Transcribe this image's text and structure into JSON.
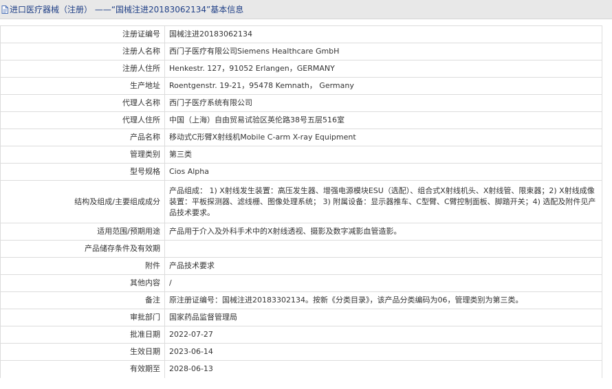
{
  "header": {
    "icon": "document-icon",
    "title": "进口医疗器械（注册） ——“国械注进20183062134”基本信息"
  },
  "rows": [
    {
      "label": "注册证编号",
      "value": "国械注进20183062134"
    },
    {
      "label": "注册人名称",
      "value": "西门子医疗有限公司Siemens Healthcare GmbH"
    },
    {
      "label": "注册人住所",
      "value": "Henkestr. 127，91052 Erlangen，GERMANY"
    },
    {
      "label": "生产地址",
      "value": "Roentgenstr. 19-21，95478 Kemnath， Germany"
    },
    {
      "label": "代理人名称",
      "value": "西门子医疗系统有限公司"
    },
    {
      "label": "代理人住所",
      "value": "中国（上海）自由贸易试验区英伦路38号五层516室"
    },
    {
      "label": "产品名称",
      "value": "移动式C形臂X射线机Mobile C-arm X-ray Equipment"
    },
    {
      "label": "管理类别",
      "value": "第三类"
    },
    {
      "label": "型号规格",
      "value": "Cios Alpha"
    },
    {
      "label": "结构及组成/主要组成成分",
      "value": "产品组成： 1) X射线发生装置：高压发生器、增强电源模块ESU（选配）、组合式X射线机头、X射线管、限束器；2) X射线成像装置：平板探测器、滤线栅、图像处理系统； 3) 附属设备：显示器推车、C型臂、C臂控制面板、脚踏开关；4) 选配及附件见产品技术要求。"
    },
    {
      "label": "适用范围/预期用途",
      "value": "产品用于介入及外科手术中的X射线透视、摄影及数字减影血管造影。"
    },
    {
      "label": "产品储存条件及有效期",
      "value": ""
    },
    {
      "label": "附件",
      "value": "产品技术要求"
    },
    {
      "label": "其他内容",
      "value": "/"
    },
    {
      "label": "备注",
      "value": "原注册证编号：国械注进20183302134。按新《分类目录》，该产品分类编码为06，管理类别为第三类。"
    },
    {
      "label": "审批部门",
      "value": "国家药品监督管理局"
    },
    {
      "label": "批准日期",
      "value": "2022-07-27"
    },
    {
      "label": "生效日期",
      "value": "2023-06-14"
    },
    {
      "label": "有效期至",
      "value": "2028-06-13"
    }
  ]
}
